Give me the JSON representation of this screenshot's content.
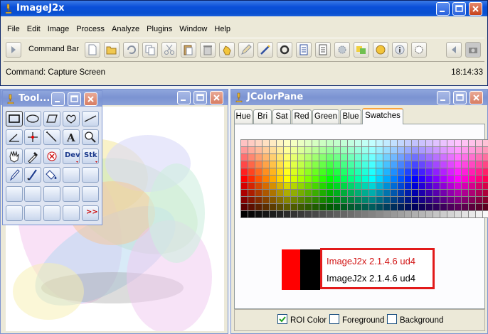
{
  "main_window": {
    "title": "ImageJ2x",
    "menu": [
      "File",
      "Edit",
      "Image",
      "Process",
      "Analyze",
      "Plugins",
      "Window",
      "Help"
    ],
    "command_bar_label": "Command Bar",
    "toolbar_icons": [
      "new-file-icon",
      "open-folder-icon",
      "undo-icon",
      "copy-icon",
      "cut-icon",
      "paste-icon",
      "delete-icon",
      "grab-hand-icon",
      "pencil-icon",
      "wand-icon",
      "loop-icon",
      "document-icon",
      "page-icon",
      "settings-icon",
      "palette-icon",
      "yellow-circle-icon",
      "info-icon",
      "sun-icon",
      "back-icon",
      "camera-icon"
    ],
    "command": "Command: Capture Screen",
    "time": "18:14:33"
  },
  "tools_window": {
    "title": "Tool...",
    "dev_label": "Dev",
    "stk_label": "Stk",
    "more_label": ">>"
  },
  "colorpane": {
    "title": "JColorPane",
    "tabs": [
      "Hue",
      "Bri",
      "Sat",
      "Red",
      "Green",
      "Blue",
      "Swatches"
    ],
    "selected_tab": "Swatches",
    "preview_fg": "#ff0000",
    "preview_bg": "#000000",
    "sample_text_top": "ImageJ2x 2.1.4.6 ud4",
    "sample_text_bottom": "ImageJ2x 2.1.4.6 ud4",
    "sample_top_color": "#d21515",
    "sample_border_color": "#e21a1a",
    "checkboxes": [
      {
        "label": "ROI Color",
        "checked": true
      },
      {
        "label": "Foreground",
        "checked": false
      },
      {
        "label": "Background",
        "checked": false
      }
    ]
  }
}
